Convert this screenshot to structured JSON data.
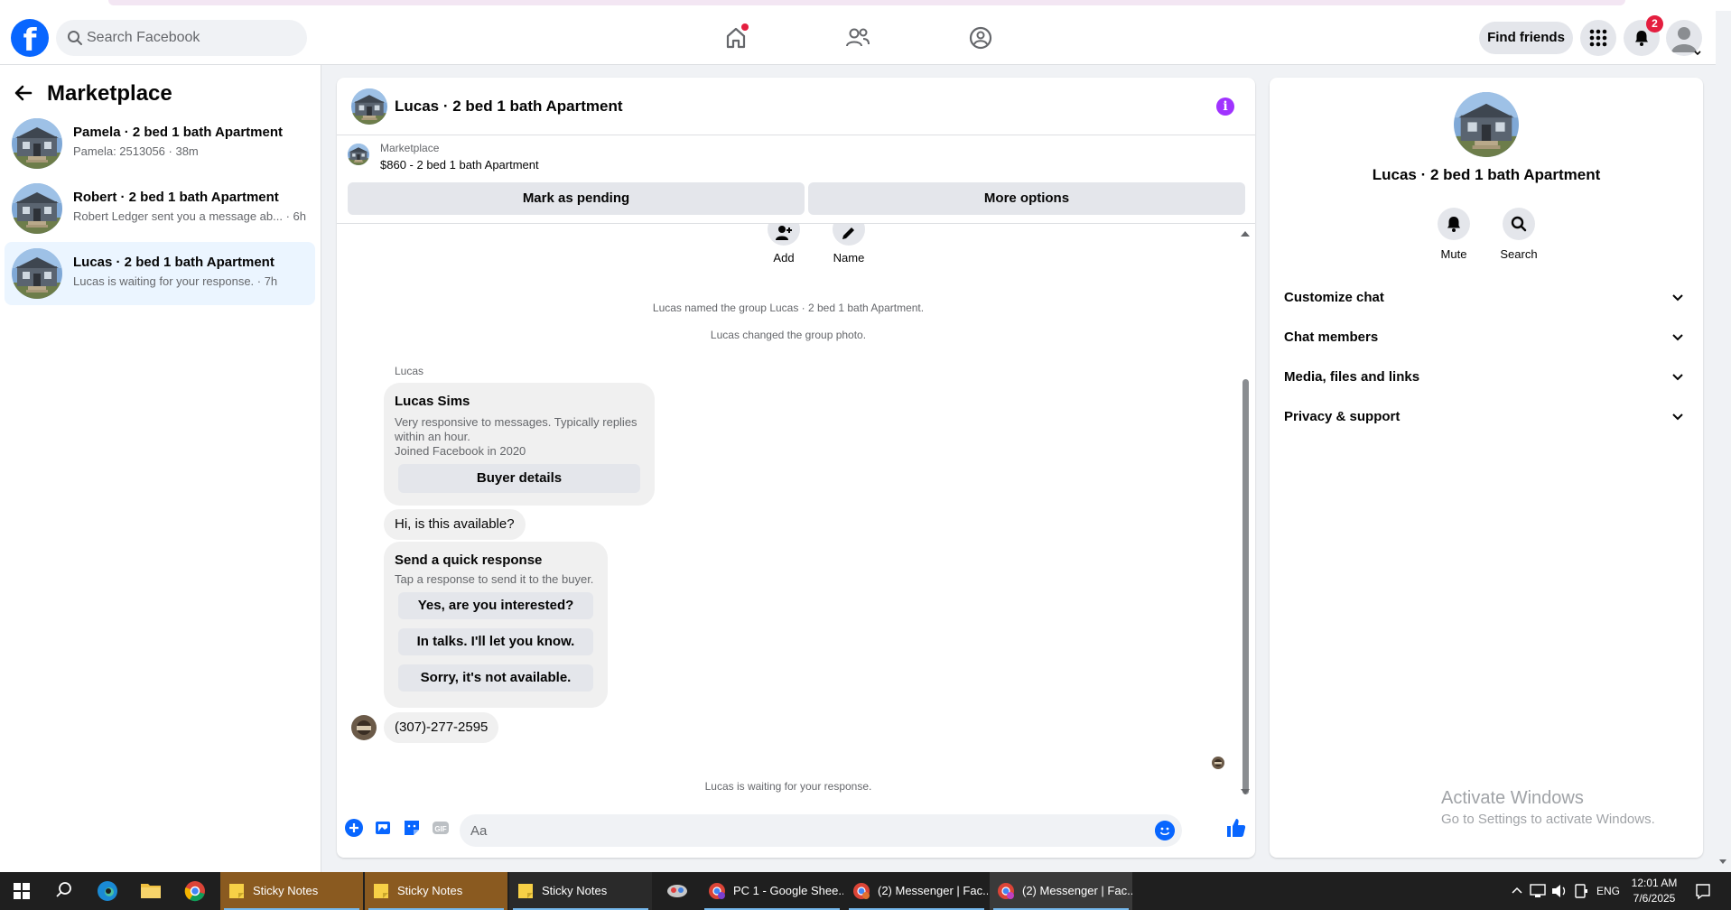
{
  "header": {
    "search_placeholder": "Search Facebook",
    "find_friends": "Find friends",
    "notification_count": "2"
  },
  "sidebar": {
    "title": "Marketplace",
    "conversations": [
      {
        "name": "Pamela · 2 bed 1 bath Apartment",
        "snippet": "Pamela: 2513056 · 38m",
        "active": false
      },
      {
        "name": "Robert · 2 bed 1 bath Apartment",
        "snippet": "Robert Ledger sent you a message ab... · 6h",
        "active": false
      },
      {
        "name": "Lucas · 2 bed 1 bath Apartment",
        "snippet": "Lucas is waiting for your response. · 7h",
        "active": true
      }
    ]
  },
  "chat": {
    "title": "Lucas · 2 bed 1 bath Apartment",
    "marketplace_label": "Marketplace",
    "listing": "$860 - 2 bed 1 bath Apartment",
    "mark_pending": "Mark as pending",
    "more_options": "More options",
    "tools": {
      "add": "Add",
      "name": "Name"
    },
    "system_messages": [
      "Lucas named the group Lucas · 2 bed 1 bath Apartment.",
      "Lucas changed the group photo."
    ],
    "sender": "Lucas",
    "profile_card": {
      "name": "Lucas Sims",
      "line1": "Very responsive to messages. Typically replies within an hour.",
      "line2": "Joined Facebook in 2020",
      "button": "Buyer details"
    },
    "message1": "Hi, is this available?",
    "quick_response": {
      "title": "Send a quick response",
      "subtitle": "Tap a response to send it to the buyer.",
      "options": [
        "Yes, are you interested?",
        "In talks. I'll let you know.",
        "Sorry, it's not available."
      ]
    },
    "message2": "(307)-277-2595",
    "waiting": "Lucas is waiting for your response.",
    "composer_placeholder": "Aa"
  },
  "right_panel": {
    "title": "Lucas · 2 bed 1 bath Apartment",
    "mute": "Mute",
    "search": "Search",
    "sections": [
      "Customize chat",
      "Chat members",
      "Media, files and links",
      "Privacy & support"
    ]
  },
  "watermark": {
    "line1": "Activate Windows",
    "line2": "Go to Settings to activate Windows."
  },
  "taskbar": {
    "items": [
      "Sticky Notes",
      "Sticky Notes",
      "Sticky Notes",
      "PC 1 - Google Shee...",
      "(2) Messenger | Fac...",
      "(2) Messenger | Fac..."
    ],
    "lang": "ENG",
    "time": "12:01 AM",
    "date": "7/6/2025"
  },
  "colors": {
    "brand": "#0866ff",
    "active_conversation": "#ebf5ff",
    "info_icon": "#a033ff",
    "badge": "#e41e3f"
  }
}
